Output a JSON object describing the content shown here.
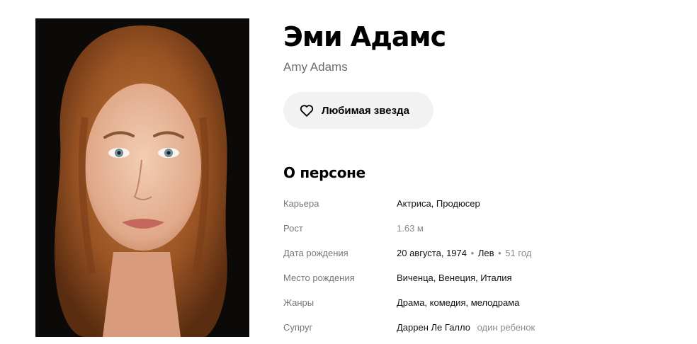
{
  "person": {
    "name": "Эми Адамс",
    "original_name": "Amy Adams",
    "favorite_button_label": "Любимая звезда",
    "photo_icon": "person-portrait"
  },
  "about": {
    "title": "О персоне",
    "rows": {
      "career": {
        "key": "Карьера",
        "value": "Актриса, Продюсер"
      },
      "height": {
        "key": "Рост",
        "value": "1.63 м"
      },
      "birth_date": {
        "key": "Дата рождения",
        "date": "20 августа, 1974",
        "zodiac": "Лев",
        "age": "51 год"
      },
      "birth_place": {
        "key": "Место рождения",
        "value": "Виченца, Венеция, Италия"
      },
      "genres": {
        "key": "Жанры",
        "value": "Драма, комедия, мелодрама"
      },
      "spouse": {
        "key": "Супруг",
        "value": "Даррен Ле Галло",
        "extra": "один ребенок"
      }
    }
  },
  "colors": {
    "button_bg": "#f2f2f2",
    "muted_text": "#777777",
    "photo_bg": "#0c0a08"
  }
}
